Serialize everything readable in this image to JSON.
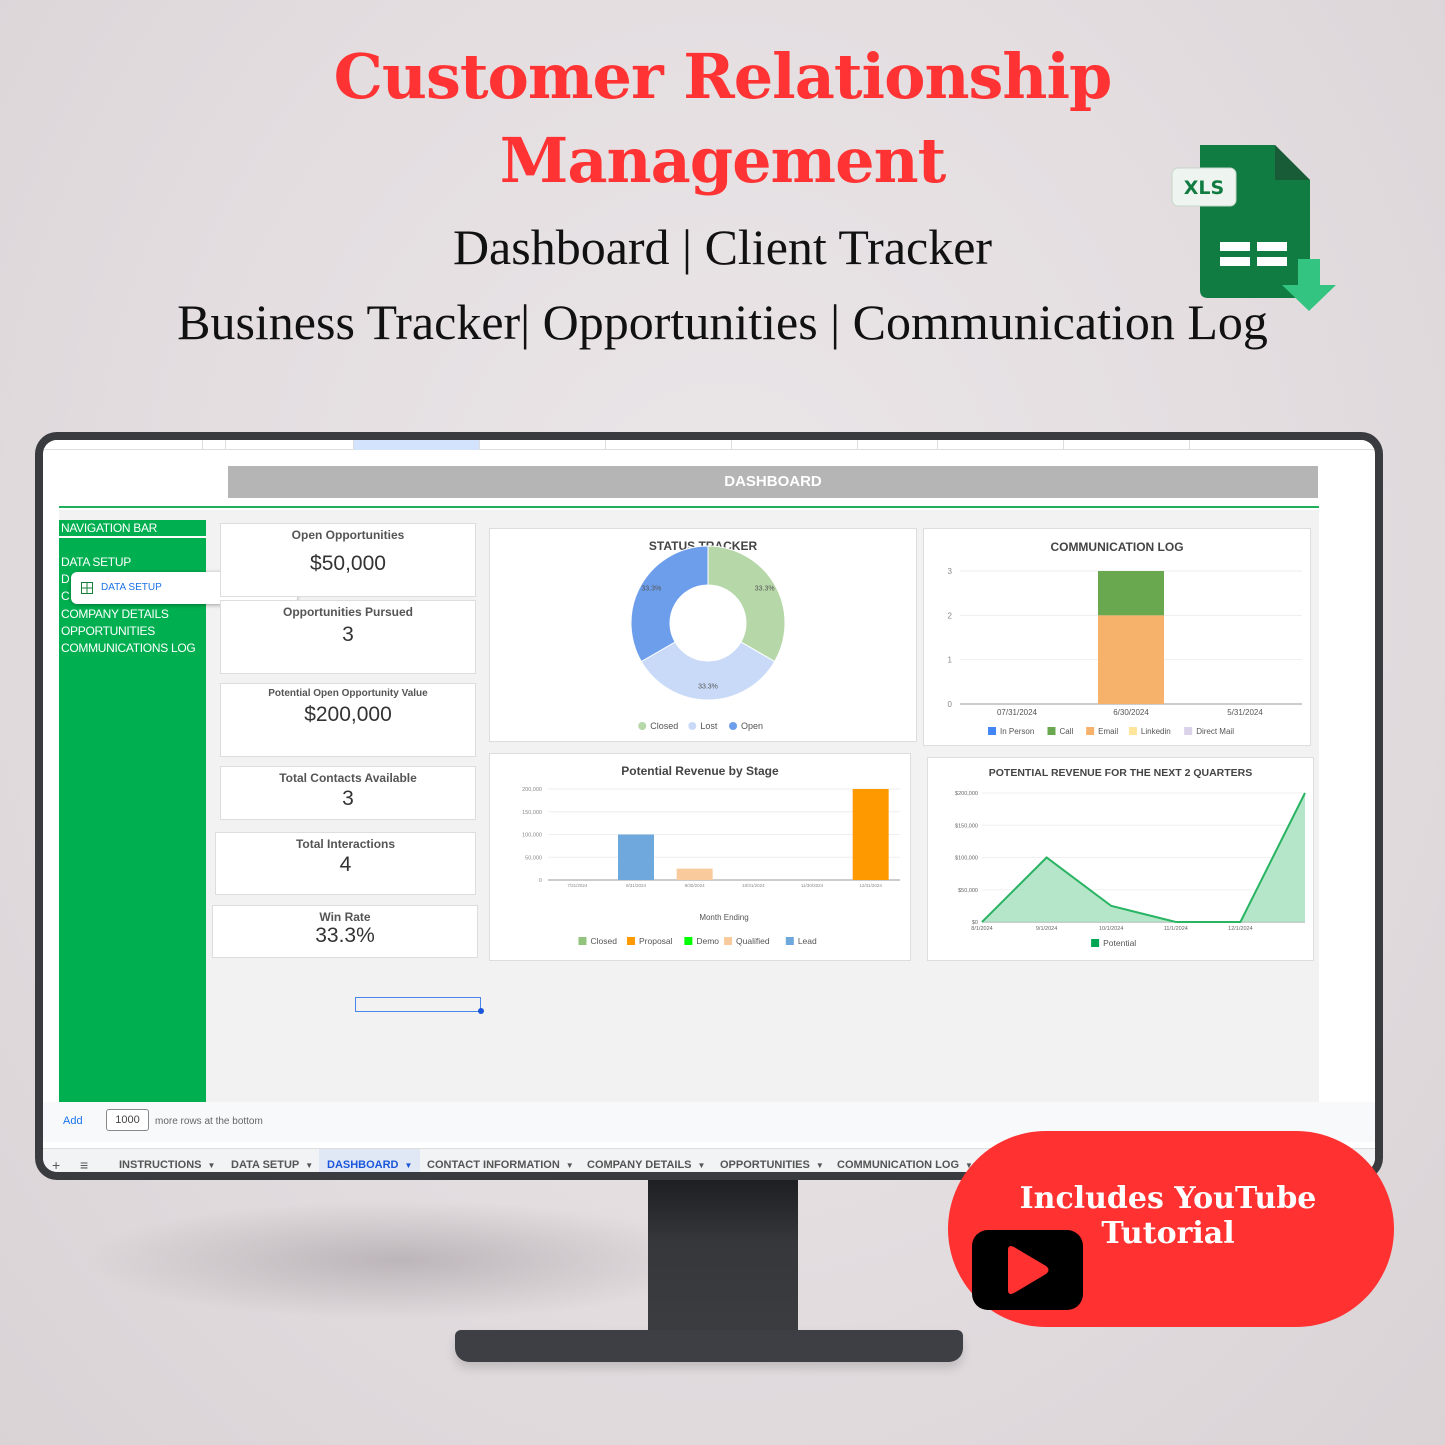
{
  "header": {
    "title_line1": "Customer Relationship",
    "title_line2": "Management",
    "subtitle_line1": "Dashboard | Client Tracker",
    "subtitle_line2": "Business Tracker| Opportunities | Communication Log",
    "file_badge": "XLS"
  },
  "sheet": {
    "banner": "DASHBOARD",
    "nav": {
      "header": "NAVIGATION BAR",
      "items": [
        "DATA SETUP",
        "D",
        "C",
        "COMPANY DETAILS",
        "OPPORTUNITIES",
        "COMMUNICATIONS LOG"
      ]
    },
    "link_popup": {
      "label": "DATA SETUP",
      "icons": [
        "copy-icon",
        "edit-icon",
        "unlink-icon"
      ]
    },
    "kpis": [
      {
        "title": "Open Opportunities",
        "value": "$50,000"
      },
      {
        "title": "Opportunities Pursued",
        "value": "3"
      },
      {
        "title": "Potential Open Opportunity Value",
        "value": "$200,000"
      },
      {
        "title": "Total Contacts Available",
        "value": "3"
      },
      {
        "title": "Total Interactions",
        "value": "4"
      },
      {
        "title": "Win Rate",
        "value": "33.3%"
      }
    ],
    "footer": {
      "add_label": "Add",
      "rows_value": "1000",
      "rows_text": "more rows at the bottom"
    },
    "tabs": [
      {
        "label": "INSTRUCTIONS",
        "active": false
      },
      {
        "label": "DATA SETUP",
        "active": false
      },
      {
        "label": "DASHBOARD",
        "active": true
      },
      {
        "label": "CONTACT INFORMATION",
        "active": false
      },
      {
        "label": "COMPANY DETAILS",
        "active": false
      },
      {
        "label": "OPPORTUNITIES",
        "active": false
      },
      {
        "label": "COMMUNICATION LOG",
        "active": false
      }
    ]
  },
  "promo": {
    "line1": "Includes YouTube",
    "line2": "Tutorial"
  },
  "chart_data": [
    {
      "id": "status",
      "type": "pie",
      "title": "STATUS TRACKER",
      "donut": true,
      "categories": [
        "Closed",
        "Lost",
        "Open"
      ],
      "values": [
        33.3,
        33.3,
        33.3
      ],
      "labels": [
        "33.3%",
        "33.3%",
        "33.3%"
      ],
      "colors": [
        "#b6d7a8",
        "#c9daf8",
        "#6d9eeb"
      ],
      "legend": "bottom"
    },
    {
      "id": "commlog",
      "type": "bar",
      "stacked": true,
      "title": "COMMUNICATION LOG",
      "categories": [
        "07/31/2024",
        "6/30/2024",
        "5/31/2024"
      ],
      "series": [
        {
          "name": "In Person",
          "values": [
            0,
            0,
            0
          ],
          "color": "#4285f4"
        },
        {
          "name": "Call",
          "values": [
            0,
            1,
            0
          ],
          "color": "#6aa84f"
        },
        {
          "name": "Email",
          "values": [
            0,
            2,
            0
          ],
          "color": "#f6b26b"
        },
        {
          "name": "Linkedin",
          "values": [
            0,
            0,
            0
          ],
          "color": "#ffe599"
        },
        {
          "name": "Direct Mail",
          "values": [
            0,
            0,
            0
          ],
          "color": "#d9d2e9"
        }
      ],
      "ylim": [
        0,
        3
      ],
      "yticks": [
        "0",
        "1",
        "2",
        "3"
      ],
      "legend": "bottom",
      "grid": true
    },
    {
      "id": "stage",
      "type": "bar",
      "title": "Potential Revenue by Stage",
      "xlabel": "Month Ending",
      "categories": [
        "7/31/2024",
        "8/31/2024",
        "9/30/2024",
        "10/31/2024",
        "11/30/2024",
        "12/31/2024"
      ],
      "series": [
        {
          "name": "Closed",
          "values": [
            0,
            0,
            0,
            0,
            0,
            0
          ],
          "color": "#93c47d"
        },
        {
          "name": "Proposal",
          "values": [
            0,
            0,
            0,
            0,
            0,
            200000
          ],
          "color": "#ff9900"
        },
        {
          "name": "Demo",
          "values": [
            0,
            0,
            0,
            0,
            0,
            0
          ],
          "color": "#00ff00"
        },
        {
          "name": "Qualified",
          "values": [
            0,
            0,
            25000,
            0,
            0,
            0
          ],
          "color": "#f9cb9c"
        },
        {
          "name": "Lead",
          "values": [
            0,
            100000,
            0,
            0,
            0,
            0
          ],
          "color": "#6fa8dc"
        }
      ],
      "ylim": [
        0,
        200000
      ],
      "yticks": [
        "0",
        "50,000",
        "100,000",
        "150,000",
        "200,000"
      ],
      "legend": "bottom",
      "grid": true
    },
    {
      "id": "quarters",
      "type": "area",
      "title": "POTENTIAL REVENUE FOR THE NEXT 2 QUARTERS",
      "x": [
        "8/1/2024",
        "9/1/2024",
        "10/1/2024",
        "11/1/2024",
        "12/1/2024",
        ""
      ],
      "series": [
        {
          "name": "Potential",
          "values": [
            0,
            100000,
            25000,
            0,
            0,
            200000
          ],
          "color": "#00a651"
        }
      ],
      "ylim": [
        0,
        200000
      ],
      "yticks": [
        "$0",
        "$50,000",
        "$100,000",
        "$150,000",
        "$200,000"
      ],
      "legend": "bottom",
      "grid": true
    }
  ]
}
